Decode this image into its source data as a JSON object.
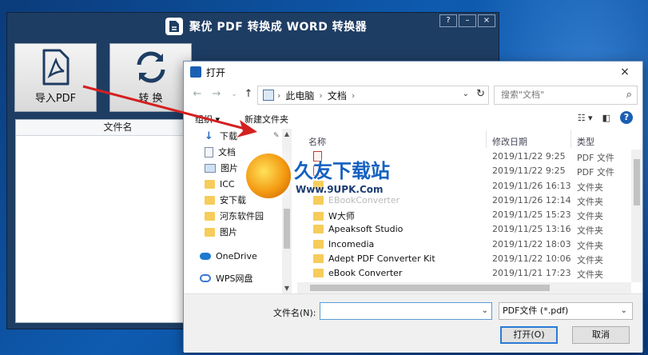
{
  "app": {
    "title": "聚优 PDF 转换成 WORD 转换器",
    "win_buttons": [
      "?",
      "–",
      "×"
    ],
    "import_label": "导入PDF",
    "convert_label": "转 换",
    "list_header": "文件名"
  },
  "dialog": {
    "title": "打开",
    "close": "×",
    "breadcrumb": [
      "此电脑",
      "文档"
    ],
    "search_placeholder": "搜索\"文档\"",
    "organize": "组织 ▾",
    "new_folder": "新建文件夹",
    "nav_items": [
      {
        "label": "下载",
        "icon": "download-arrow-icon"
      },
      {
        "label": "文档",
        "icon": "document-icon"
      },
      {
        "label": "图片",
        "icon": "picture-icon"
      },
      {
        "label": "ICC",
        "icon": "folder-icon"
      },
      {
        "label": "安下载",
        "icon": "folder-icon"
      },
      {
        "label": "河东软件园",
        "icon": "folder-icon"
      },
      {
        "label": "图片",
        "icon": "folder-icon"
      },
      {
        "label": "OneDrive",
        "icon": "onedrive-cloud-icon"
      },
      {
        "label": "WPS网盘",
        "icon": "wps-cloud-icon"
      }
    ],
    "columns": {
      "name": "名称",
      "date": "修改日期",
      "type": "类型"
    },
    "files": [
      {
        "name": "",
        "date": "2019/11/22 9:25",
        "type": "PDF 文件",
        "kind": "pdf"
      },
      {
        "name": "",
        "date": "2019/11/22 9:25",
        "type": "PDF 文件",
        "kind": "pdf"
      },
      {
        "name": "",
        "date": "2019/11/26 16:13",
        "type": "文件夹",
        "kind": "folder"
      },
      {
        "name": "EBookConverter",
        "date": "2019/11/26 12:14",
        "type": "文件夹",
        "kind": "folder"
      },
      {
        "name": "W大师",
        "date": "2019/11/25 15:23",
        "type": "文件夹",
        "kind": "folder"
      },
      {
        "name": "Apeaksoft Studio",
        "date": "2019/11/25 13:16",
        "type": "文件夹",
        "kind": "folder"
      },
      {
        "name": "Incomedia",
        "date": "2019/11/22 18:03",
        "type": "文件夹",
        "kind": "folder"
      },
      {
        "name": "Adept PDF Converter Kit",
        "date": "2019/11/22 10:06",
        "type": "文件夹",
        "kind": "folder"
      },
      {
        "name": "eBook Converter",
        "date": "2019/11/21 17:23",
        "type": "文件夹",
        "kind": "folder"
      }
    ],
    "filename_label": "文件名(N):",
    "filename_value": "",
    "filetype": "PDF文件 (*.pdf)",
    "open_button": "打开(O)",
    "cancel_button": "取消"
  },
  "watermark": {
    "title": "久友下载站",
    "url": "Www.9UPK.Com"
  },
  "colors": {
    "app_bg": "#1e3d63",
    "accent": "#2a7ad5",
    "arrow": "#d42020"
  }
}
